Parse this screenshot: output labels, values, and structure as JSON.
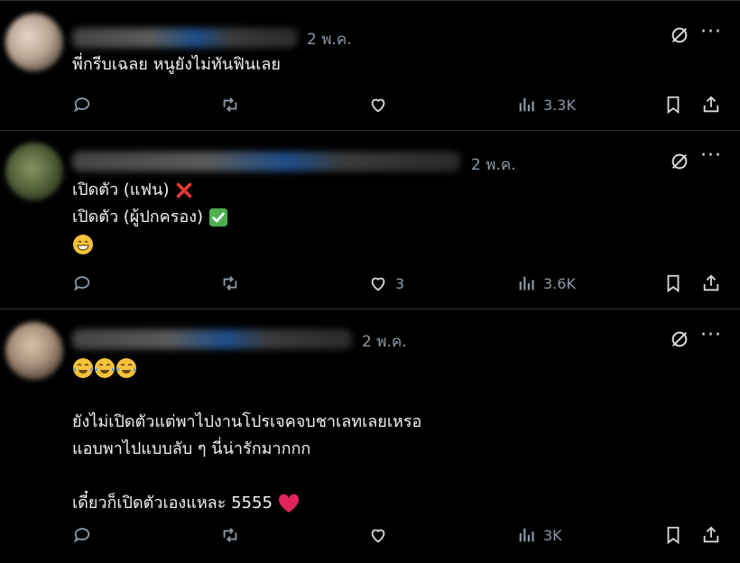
{
  "tweets": [
    {
      "date": "2 พ.ค.",
      "lines": [
        "พี่กรีบเฉลย หนูยังไม่ทันฟินเลย"
      ],
      "likes": "",
      "views": "3.3K"
    },
    {
      "date": "2 พ.ค.",
      "lines": [
        "เปิดตัว (แฟน)",
        "เปิดตัว (ผู้ปกครอง)"
      ],
      "likes": "3",
      "views": "3.6K"
    },
    {
      "date": "2 พ.ค.",
      "lines": [
        "ยังไม่เปิดตัวแต่พาไปงานโปรเจคจบชาเลทเลยเหรอ",
        "แอบพาไปแบบลับ ๆ นี่น่ารักมากกก",
        "เดี๋ยวก็เปิดตัวเองแหละ 5555"
      ],
      "likes": "",
      "views": "3K"
    }
  ],
  "colors": {
    "background": "#000000",
    "text": "#e7e9ea",
    "muted": "#8b98a5",
    "divider": "#2f3336",
    "heart": "#e0245e",
    "check": "#4caf50",
    "cross": "#e53935"
  }
}
